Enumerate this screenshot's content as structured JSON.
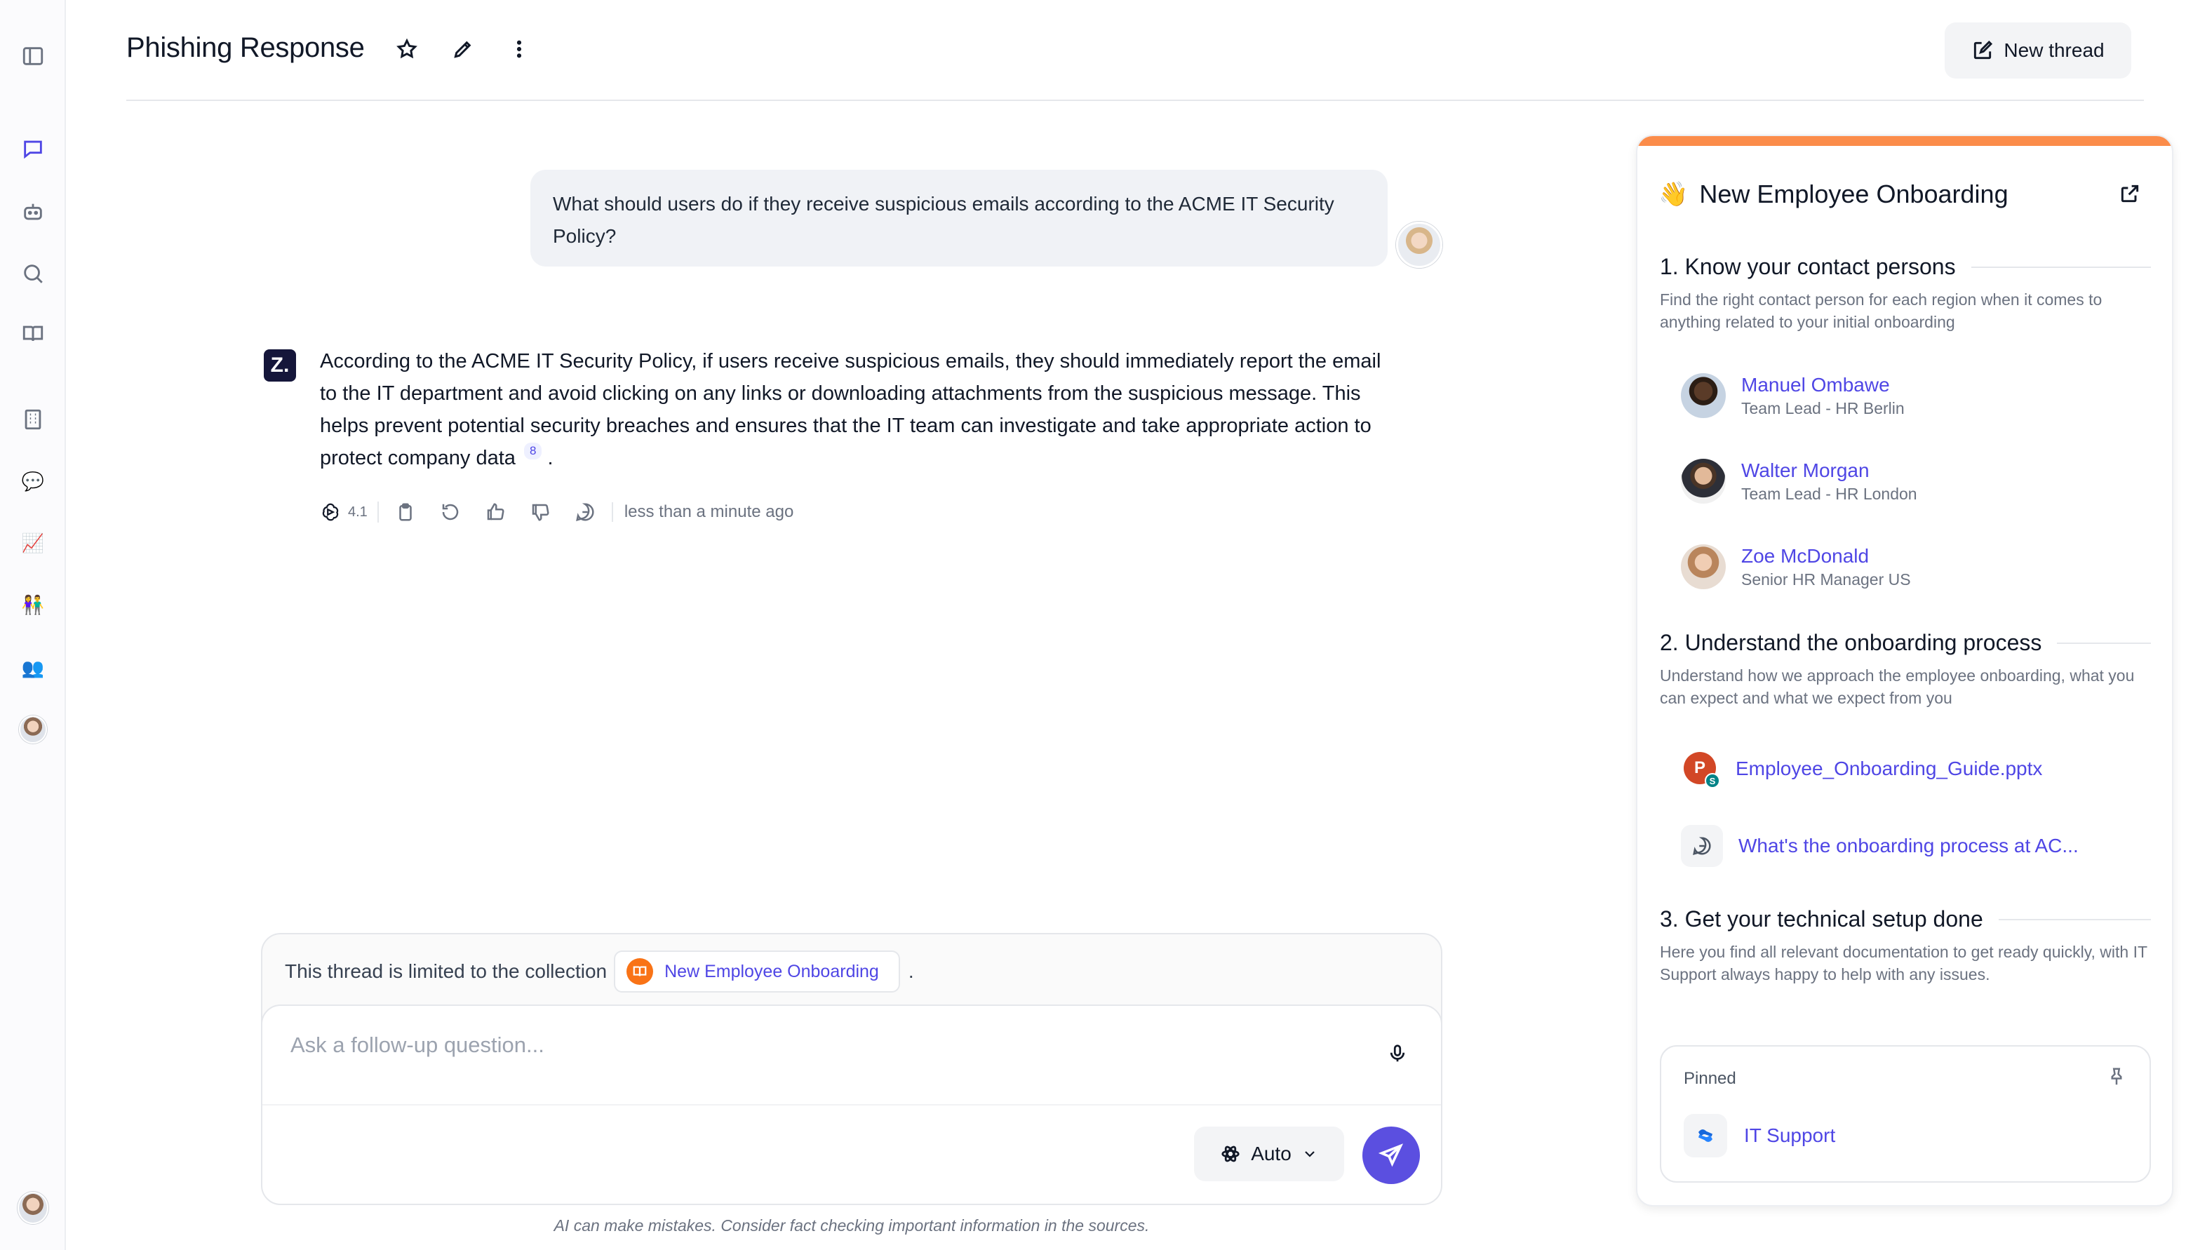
{
  "header": {
    "title": "Phishing Response",
    "new_thread_label": "New thread"
  },
  "conversation": {
    "user_message": "What should users do if they receive suspicious emails according to the ACME IT Security Policy?",
    "bot_logo": "Z.",
    "bot_message": "According to the ACME IT Security Policy, if users receive suspicious emails, they should immediately report the email to the IT department and avoid clicking on any links or downloading attachments from the suspicious message. This helps prevent potential security breaches and ensures that the IT team can investigate and take appropriate action to protect company data",
    "citation": "8",
    "bot_message_end": ".",
    "model_version": "4.1",
    "timestamp": "less than a minute ago"
  },
  "composer": {
    "scope_prefix": "This thread is limited to the collection",
    "scope_collection": "New Employee Onboarding",
    "scope_suffix": ".",
    "placeholder": "Ask a follow-up question...",
    "model_selector": "Auto",
    "disclaimer": "AI can make mistakes. Consider fact checking important information in the sources."
  },
  "panel": {
    "emoji": "👋",
    "title": "New Employee Onboarding",
    "accent_color": "#fb8c4a",
    "sections": [
      {
        "heading": "1. Know your contact persons",
        "description": "Find the right contact person for each region when it comes to anything related to your initial onboarding",
        "contacts": [
          {
            "name": "Manuel Ombawe",
            "role": "Team Lead - HR Berlin"
          },
          {
            "name": "Walter Morgan",
            "role": "Team Lead - HR London"
          },
          {
            "name": "Zoe McDonald",
            "role": "Senior HR Manager US"
          }
        ]
      },
      {
        "heading": "2. Understand the onboarding process",
        "description": "Understand how we approach the employee onboarding, what you can expect and what we expect from you",
        "links": [
          {
            "label": "Employee_Onboarding_Guide.pptx",
            "icon": "powerpoint-icon"
          },
          {
            "label": "What's the onboarding process at AC...",
            "icon": "chat-icon"
          }
        ]
      },
      {
        "heading": "3. Get your technical setup done",
        "description": "Here you find all relevant documentation to get ready quickly, with IT Support always happy to help with any issues."
      }
    ],
    "pinned": {
      "label": "Pinned",
      "item": "IT Support"
    }
  },
  "colors": {
    "brand": "#4f46e5",
    "send_button": "#5b4fe0",
    "collection_icon": "#f97316"
  }
}
